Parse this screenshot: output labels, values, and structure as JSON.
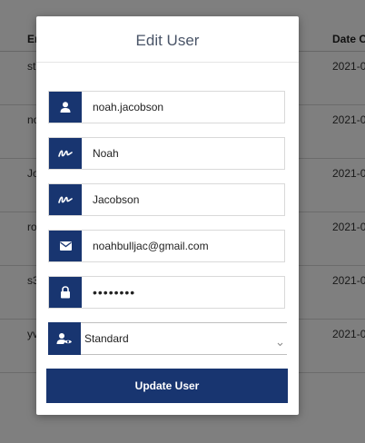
{
  "table": {
    "headers": {
      "email": "Em",
      "date_created": "Date C"
    },
    "rows": [
      {
        "email": "st",
        "date": "2021-0"
      },
      {
        "email": "no",
        "date": "2021-0"
      },
      {
        "email": "Jo",
        "date": "2021-0"
      },
      {
        "email": "ro",
        "date": "2021-0"
      },
      {
        "email": "s3",
        "date": "2021-0"
      },
      {
        "email": "yv",
        "date": "2021-0"
      }
    ]
  },
  "modal": {
    "title": "Edit User",
    "fields": {
      "username": {
        "value": "noah.jacobson",
        "icon": "user-icon"
      },
      "first_name": {
        "value": "Noah",
        "icon": "signature-icon"
      },
      "last_name": {
        "value": "Jacobson",
        "icon": "signature-icon"
      },
      "email": {
        "value": "noahbulljac@gmail.com",
        "icon": "envelope-icon"
      },
      "password": {
        "value": "••••••••",
        "icon": "lock-icon"
      },
      "role": {
        "value": "Standard",
        "icon": "user-eye-icon"
      }
    },
    "submit_label": "Update User"
  },
  "colors": {
    "primary": "#183570",
    "overlay": "rgba(0,0,0,0.5)"
  }
}
